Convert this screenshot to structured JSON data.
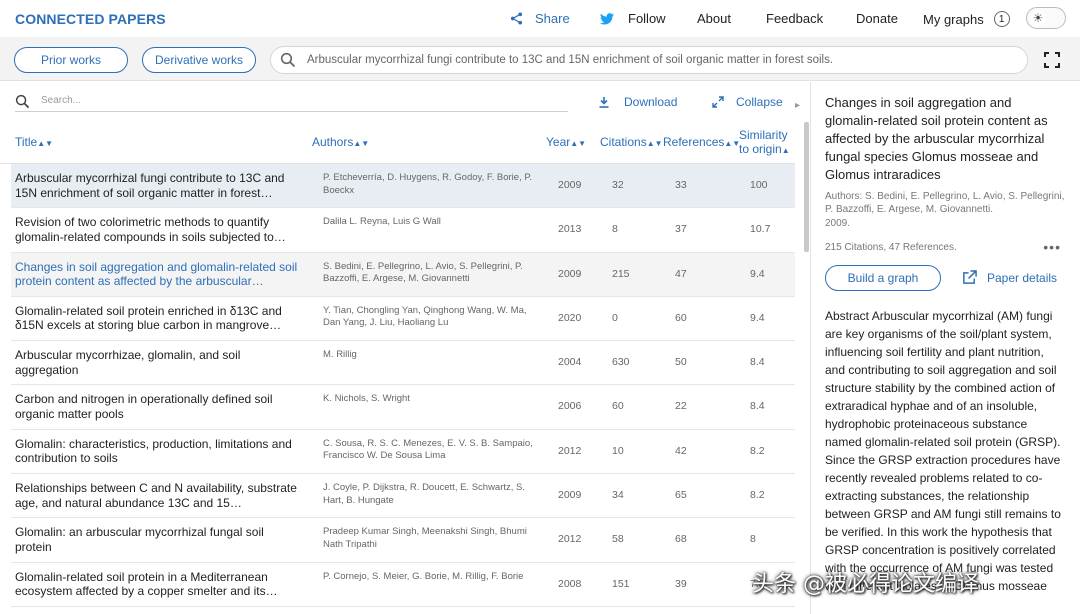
{
  "brand": "CONNECTED PAPERS",
  "nav": {
    "share": "Share",
    "follow": "Follow",
    "about": "About",
    "feedback": "Feedback",
    "donate": "Donate",
    "my_graphs": "My graphs",
    "my_graphs_count": "1"
  },
  "subbar": {
    "prior": "Prior works",
    "derivative": "Derivative works",
    "query": "Arbuscular mycorrhizal fungi contribute to 13C and 15N enrichment of soil organic matter in forest soils."
  },
  "table": {
    "search_placeholder": "Search...",
    "download": "Download",
    "collapse": "Collapse",
    "headers": {
      "title": "Title",
      "authors": "Authors",
      "year": "Year",
      "citations": "Citations",
      "references": "References",
      "similarity_1": "Similarity",
      "similarity_2": "to origin"
    },
    "rows": [
      {
        "title": "Arbuscular mycorrhizal fungi contribute to 13C and 15N enrichment of soil organic matter in forest…",
        "authors": "P. Etcheverría, D. Huygens, R. Godoy, F. Borie, P. Boeckx",
        "year": "2009",
        "citations": "32",
        "references": "33",
        "similarity": "100"
      },
      {
        "title": "Revision of two colorimetric methods to quantify glomalin-related compounds in soils subjected to…",
        "authors": "Dalila L. Reyna, Luis G Wall",
        "year": "2013",
        "citations": "8",
        "references": "37",
        "similarity": "10.7"
      },
      {
        "title": "Changes in soil aggregation and glomalin-related soil protein content as affected by the arbuscular…",
        "authors": "S. Bedini, E. Pellegrino, L. Avio, S. Pellegrini, P. Bazzoffi, E. Argese, M. Giovannetti",
        "year": "2009",
        "citations": "215",
        "references": "47",
        "similarity": "9.4"
      },
      {
        "title": "Glomalin-related soil protein enriched in δ13C and δ15N excels at storing blue carbon in mangrove…",
        "authors": "Y. Tian, Chongling Yan, Qinghong Wang, W. Ma, Dan Yang, J. Liu, Haoliang Lu",
        "year": "2020",
        "citations": "0",
        "references": "60",
        "similarity": "9.4"
      },
      {
        "title": "Arbuscular mycorrhizae, glomalin, and soil aggregation",
        "authors": "M. Rillig",
        "year": "2004",
        "citations": "630",
        "references": "50",
        "similarity": "8.4"
      },
      {
        "title": "Carbon and nitrogen in operationally defined soil organic matter pools",
        "authors": "K. Nichols, S. Wright",
        "year": "2006",
        "citations": "60",
        "references": "22",
        "similarity": "8.4"
      },
      {
        "title": "Glomalin: characteristics, production, limitations and contribution to soils",
        "authors": "C. Sousa, R. S. C. Menezes, E. V. S. B. Sampaio, Francisco W. De Sousa Lima",
        "year": "2012",
        "citations": "10",
        "references": "42",
        "similarity": "8.2"
      },
      {
        "title": "Relationships between C and N availability, substrate age, and natural abundance 13C and 15…",
        "authors": "J. Coyle, P. Dijkstra, R. Doucett, E. Schwartz, S. Hart, B. Hungate",
        "year": "2009",
        "citations": "34",
        "references": "65",
        "similarity": "8.2"
      },
      {
        "title": "Glomalin: an arbuscular mycorrhizal fungal soil protein",
        "authors": "Pradeep Kumar Singh, Meenakshi Singh, Bhumi Nath Tripathi",
        "year": "2012",
        "citations": "58",
        "references": "68",
        "similarity": "8"
      },
      {
        "title": "Glomalin-related soil protein in a Mediterranean ecosystem affected by a copper smelter and its…",
        "authors": "P. Cornejo, S. Meier, G. Borie, M. Rillig, F. Borie",
        "year": "2008",
        "citations": "151",
        "references": "39",
        "similarity": "7.8"
      }
    ]
  },
  "panel": {
    "title": "Changes in soil aggregation and glomalin-related soil protein content as affected by the arbuscular mycorrhizal fungal species Glomus mosseae and Glomus intraradices",
    "authors": "Authors: S. Bedini, E. Pellegrino, L. Avio, S. Pellegrini, P. Bazzoffi, E. Argese, M. Giovannetti.",
    "year": "2009.",
    "stats": "215 Citations, 47 References.",
    "build_graph": "Build a graph",
    "paper_details": "Paper details",
    "abstract": "Abstract Arbuscular mycorrhizal (AM) fungi are key organisms of the soil/plant system, influencing soil fertility and plant nutrition, and contributing to soil aggregation and soil structure stability by the combined action of extraradical hyphae and of an insoluble, hydrophobic proteinaceous substance named glomalin-related soil protein (GRSP). Since the GRSP extraction procedures have recently revealed problems related to co-extracting substances, the relationship between GRSP and AM fungi still remains to be verified. In this work the hypothesis that GRSP concentration is positively correlated with the occurrence of AM fungi was tested with different isolates of Glomus mosseae"
  },
  "watermark": "头条 @被必得论文编译",
  "colors": {
    "accent": "#2e6fb7",
    "selected_row": "#e8edf3"
  }
}
